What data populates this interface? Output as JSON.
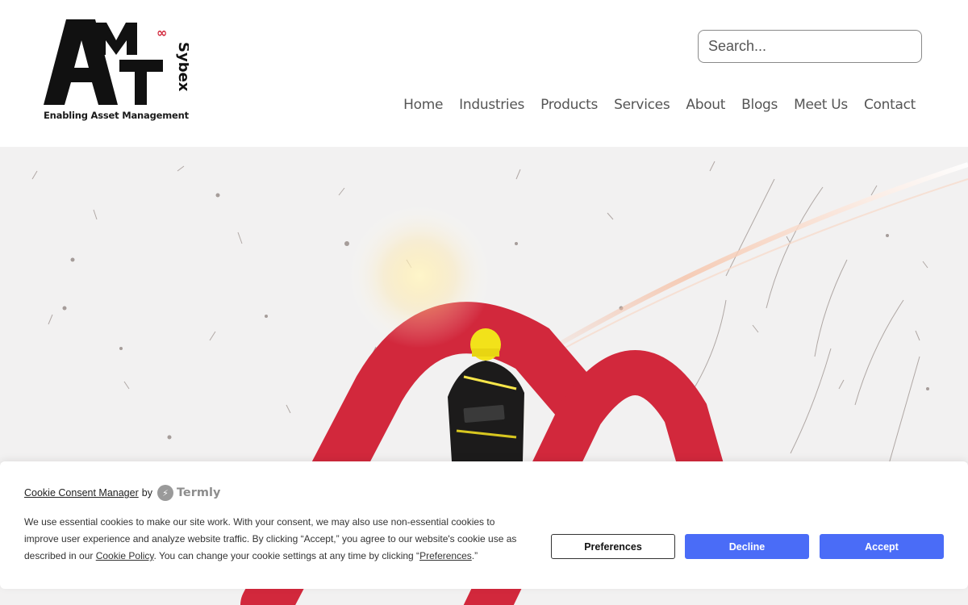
{
  "header": {
    "logo": {
      "letters": [
        "A",
        "M",
        "T"
      ],
      "brand_vertical": "Sybex",
      "tagline": "Enabling Asset Management"
    },
    "search": {
      "placeholder": "Search...",
      "value": ""
    },
    "nav": [
      "Home",
      "Industries",
      "Products",
      "Services",
      "About",
      "Blogs",
      "Meet Us",
      "Contact"
    ]
  },
  "cookie_banner": {
    "manager_link": "Cookie Consent Manager",
    "by": "by",
    "provider": "Termly",
    "text_part1": "We use essential cookies to make our site work. With your consent, we may also use non-essential cookies to improve user experience and analyze website traffic. By clicking “Accept,” you agree to our website's cookie use as described in our ",
    "cookie_policy_link": "Cookie Policy",
    "text_part2": ". You can change your cookie settings at any time by clicking “",
    "preferences_link": "Preferences",
    "text_part3": ".”",
    "buttons": {
      "preferences": "Preferences",
      "decline": "Decline",
      "accept": "Accept"
    }
  },
  "colors": {
    "brand_red": "#d2283c",
    "button_blue": "#4a6cf7",
    "nav_text": "#555555"
  }
}
